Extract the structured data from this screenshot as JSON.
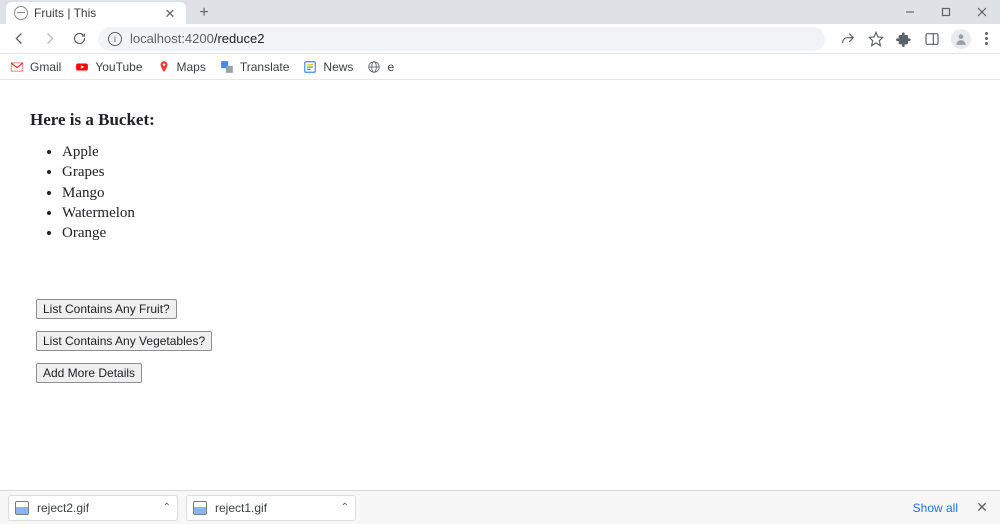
{
  "tab": {
    "title": "Fruits | This"
  },
  "url": {
    "host": "localhost",
    "port": ":4200",
    "path": "/reduce2"
  },
  "bookmarks": [
    {
      "label": "Gmail"
    },
    {
      "label": "YouTube"
    },
    {
      "label": "Maps"
    },
    {
      "label": "Translate"
    },
    {
      "label": "News"
    },
    {
      "label": "e"
    }
  ],
  "page": {
    "heading": "Here is a Bucket:",
    "items": [
      "Apple",
      "Grapes",
      "Mango",
      "Watermelon",
      "Orange"
    ],
    "buttons": {
      "fruit": "List Contains Any Fruit?",
      "veg": "List Contains Any Vegetables?",
      "more": "Add More Details"
    }
  },
  "downloads": {
    "items": [
      "reject2.gif",
      "reject1.gif"
    ],
    "showall": "Show all"
  }
}
